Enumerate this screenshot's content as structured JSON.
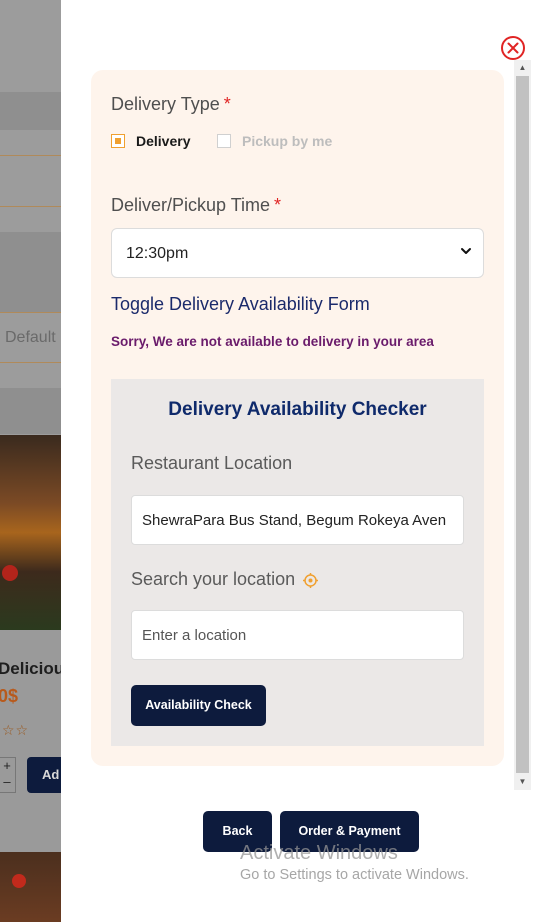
{
  "background_page": {
    "sort_text": "Default",
    "product_title": "Deliciou",
    "product_price": "0$",
    "rating_stars": "☆☆",
    "qty_plus": "+",
    "qty_minus": "–",
    "add_label": "Ad"
  },
  "modal": {
    "delivery_type": {
      "label": "Delivery Type",
      "required_mark": "*",
      "options": [
        {
          "label": "Delivery",
          "selected": true
        },
        {
          "label": "Pickup by me",
          "selected": false
        }
      ]
    },
    "time": {
      "label": "Deliver/Pickup Time",
      "required_mark": "*",
      "selected": "12:30pm"
    },
    "toggle_link": "Toggle Delivery Availability Form",
    "error_message": "Sorry, We are not available to delivery in your area",
    "checker": {
      "title": "Delivery Availability Checker",
      "restaurant_label": "Restaurant Location",
      "restaurant_value": "ShewraPara Bus Stand, Begum Rokeya Aven",
      "search_label": "Search your location",
      "search_placeholder": "Enter a location",
      "check_button": "Availability Check"
    },
    "footer": {
      "back_button": "Back",
      "order_button": "Order & Payment"
    }
  },
  "watermark": {
    "title": "Activate Windows",
    "subtitle": "Go to Settings to activate Windows."
  },
  "colors": {
    "accent_navy": "#0d1b3d",
    "required_red": "#e02424",
    "close_red": "#e02424",
    "radio_orange": "#f0a030",
    "error_purple": "#6a1b6b",
    "title_blue": "#0f2a6b",
    "form_background": "#fef4ec",
    "checker_background": "#ebe8e7"
  },
  "icons": {
    "close": "close-circle-icon",
    "location": "target-location-icon",
    "select": "chevron-down-icon"
  }
}
